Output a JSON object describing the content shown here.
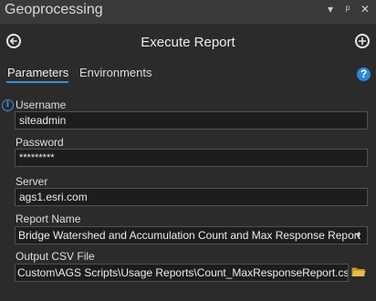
{
  "pane": {
    "title": "Geoprocessing",
    "controls": [
      "▾",
      "ᵖ",
      "✕"
    ]
  },
  "tool": {
    "title": "Execute Report"
  },
  "tabs": [
    {
      "label": "Parameters",
      "active": true
    },
    {
      "label": "Environments",
      "active": false
    }
  ],
  "help": {
    "glyph": "?"
  },
  "info": {
    "glyph": "i"
  },
  "params": {
    "username": {
      "label": "Username",
      "value": "siteadmin"
    },
    "password": {
      "label": "Password",
      "value": "*********"
    },
    "server": {
      "label": "Server",
      "value": "ags1.esri.com"
    },
    "report": {
      "label": "Report Name",
      "value": "Bridge Watershed and Accumulation Count and Max Response Report"
    },
    "output": {
      "label": "Output CSV File",
      "value": "Custom\\AGS Scripts\\Usage Reports\\Count_MaxResponseReport.csv"
    }
  },
  "colors": {
    "accent": "#3d8bd8",
    "background": "#2b2b2b",
    "folder": "#e0b53a"
  }
}
